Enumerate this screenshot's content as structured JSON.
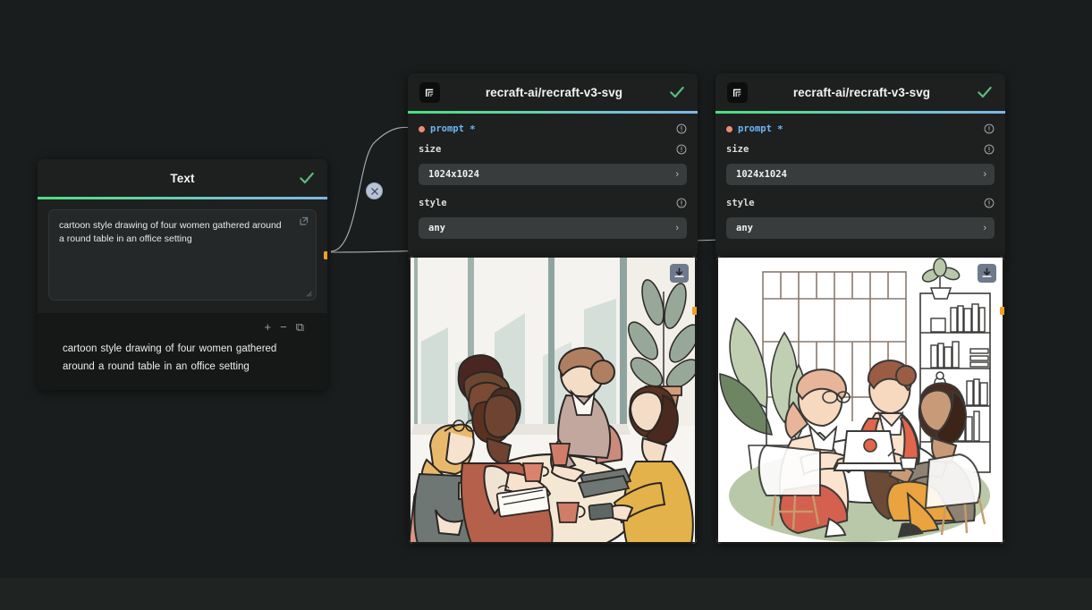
{
  "canvas": {
    "background": "#1a1d1d"
  },
  "text_node": {
    "title": "Text",
    "status_icon": "check-icon",
    "prompt_value": "cartoon style drawing of four women gathered around a round table in an office setting",
    "expand_icon": "external-link-icon",
    "resize_icon": "resize-grip-icon",
    "output_text": "cartoon style drawing of four women gathered around a round table in an office setting",
    "controls": [
      {
        "name": "increase-font-button",
        "glyph": "+"
      },
      {
        "name": "decrease-font-button",
        "glyph": "−"
      },
      {
        "name": "copy-button",
        "glyph": "⧉"
      }
    ]
  },
  "model_nodes": [
    {
      "title": "recraft-ai/recraft-v3-svg",
      "logo_icon": "recraft-logo-icon",
      "status_icon": "check-icon",
      "params": [
        {
          "label": "prompt",
          "required": true,
          "connected": true,
          "type": "connection"
        },
        {
          "label": "size",
          "value": "1024x1024",
          "type": "select"
        },
        {
          "label": "style",
          "value": "any",
          "type": "select"
        }
      ]
    },
    {
      "title": "recraft-ai/recraft-v3-svg",
      "logo_icon": "recraft-logo-icon",
      "status_icon": "check-icon",
      "params": [
        {
          "label": "prompt",
          "required": true,
          "connected": true,
          "type": "connection"
        },
        {
          "label": "size",
          "value": "1024x1024",
          "type": "select"
        },
        {
          "label": "style",
          "value": "any",
          "type": "select"
        }
      ]
    }
  ],
  "images": [
    {
      "alt": "cartoon illustration of four women seated around a round table in an office with city-view windows and a potted plant",
      "download_icon": "download-icon"
    },
    {
      "alt": "line-art illustration of three women around a round table with a laptop, bookshelf, plants and a window",
      "download_icon": "download-icon"
    }
  ],
  "edge": {
    "delete_icon": "close-icon",
    "port_color": "#f0a023"
  },
  "colors": {
    "accent_gradient_start": "#4ade80",
    "accent_gradient_end": "#7cb6e8",
    "check_green": "#5dbb7e",
    "prompt_blue": "#6cb6f5",
    "required_dot": "#f08a72",
    "port_orange": "#f0a023",
    "node_bg": "#1e2020",
    "select_bg": "#383c3c"
  }
}
